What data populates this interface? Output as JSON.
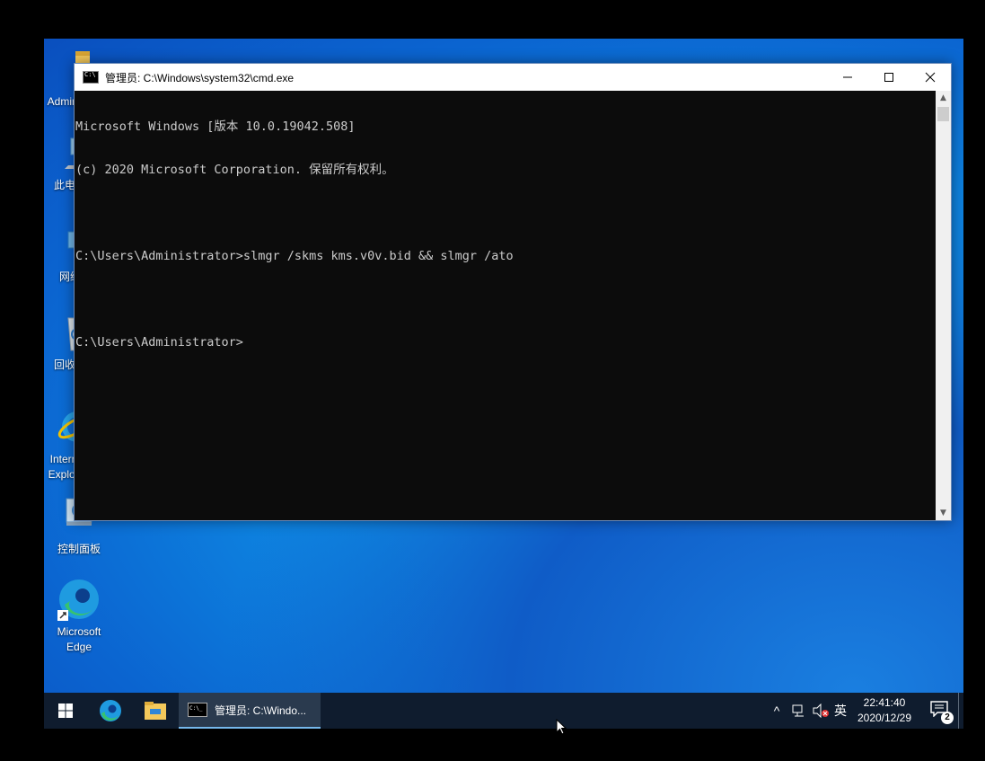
{
  "desktop": {
    "icons": [
      {
        "label": "Administrator",
        "icon": "user-folder-icon"
      },
      {
        "label": "此电脑",
        "icon": "this-pc-icon"
      },
      {
        "label": "网络",
        "icon": "network-icon"
      },
      {
        "label": "回收站",
        "icon": "recycle-bin-icon"
      },
      {
        "label": "Internet\nExplorer",
        "icon": "internet-explorer-icon"
      },
      {
        "label": "控制面板",
        "icon": "control-panel-icon"
      },
      {
        "label": "Microsoft\nEdge",
        "icon": "edge-icon"
      }
    ]
  },
  "window": {
    "title": "管理员: C:\\Windows\\system32\\cmd.exe",
    "minimize_glyph": "—",
    "maximize_glyph": "☐",
    "close_glyph": "✕"
  },
  "console": {
    "lines": [
      "Microsoft Windows [版本 10.0.19042.508]",
      "(c) 2020 Microsoft Corporation. 保留所有权利。",
      "",
      "C:\\Users\\Administrator>slmgr /skms kms.v0v.bid && slmgr /ato",
      "",
      "C:\\Users\\Administrator>"
    ]
  },
  "taskbar": {
    "cmd_label": "管理员: C:\\Windo...",
    "tray": {
      "chevron": "^",
      "ime": "英",
      "time": "22:41:40",
      "date": "2020/12/29",
      "notification_count": "2"
    }
  },
  "colors": {
    "console_bg": "#0c0c0c",
    "console_fg": "#cccccc",
    "taskbar_bg": "#0f1c2e",
    "accent": "#76b9ed"
  }
}
